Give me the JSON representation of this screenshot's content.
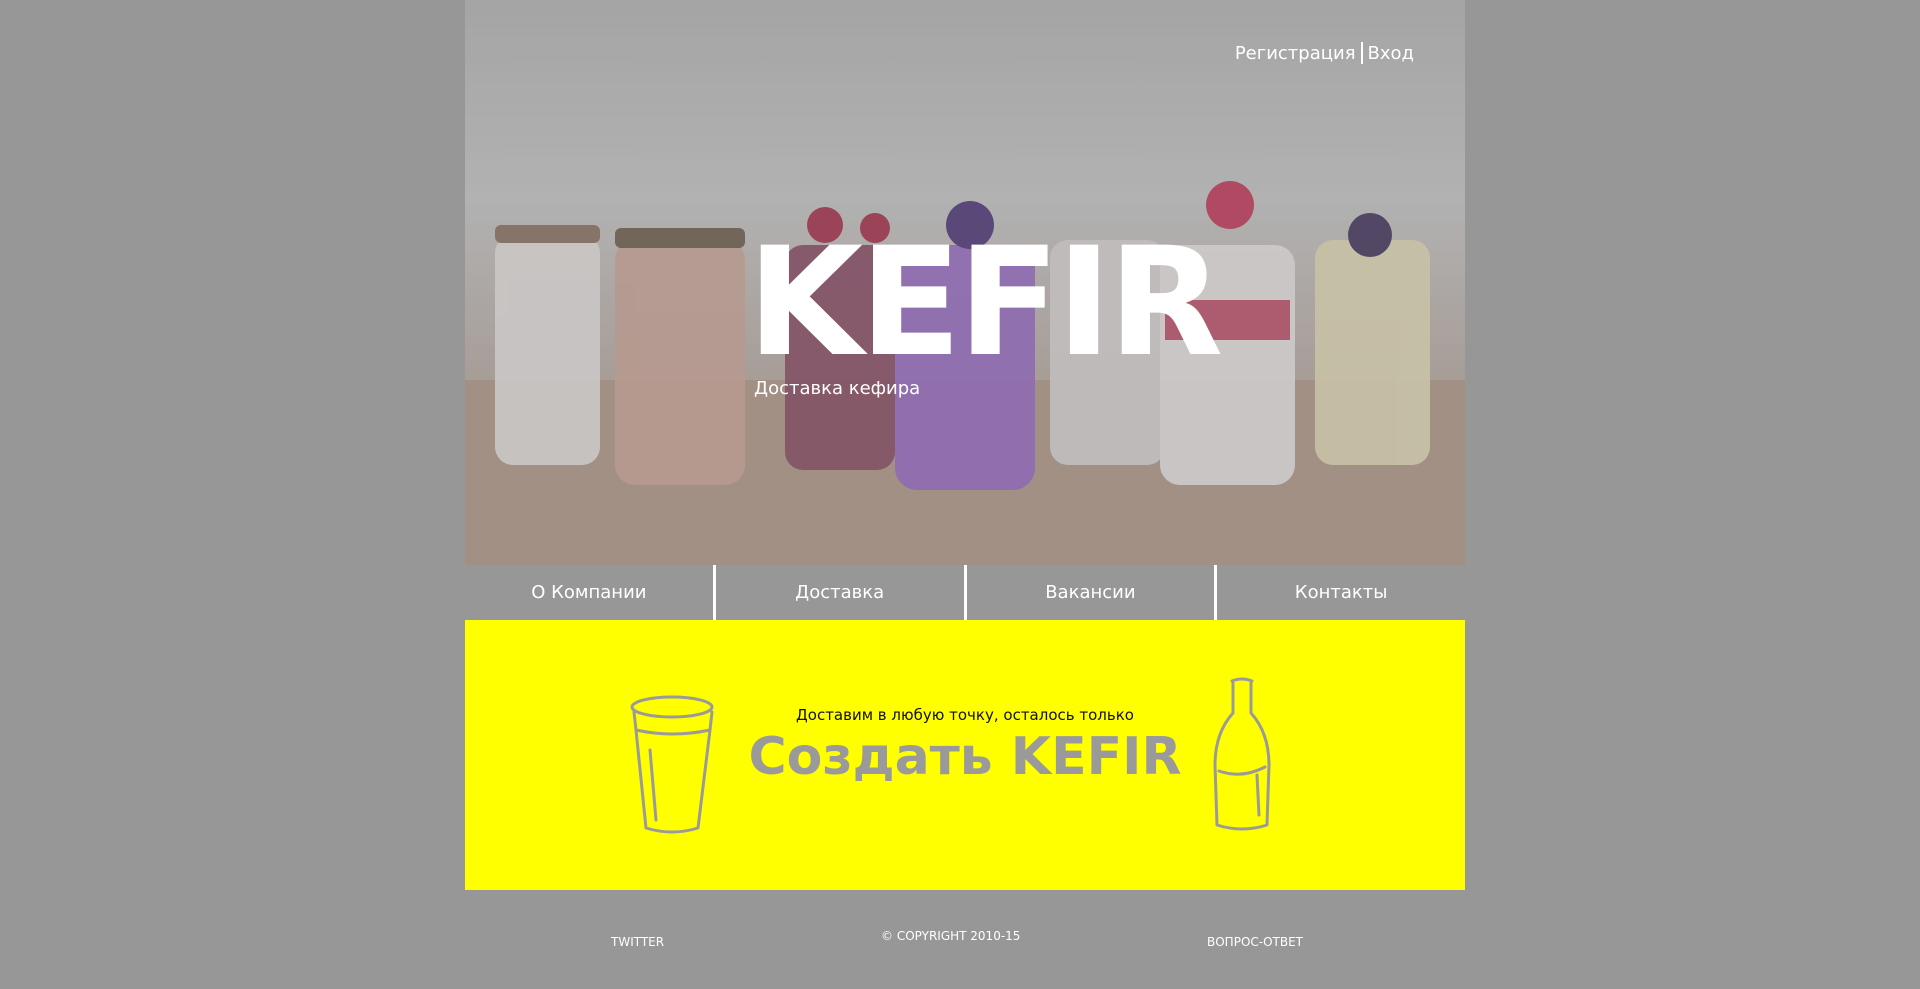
{
  "header": {
    "register_label": "Регистрация",
    "login_label": "Вход"
  },
  "hero": {
    "brand": "KEFIR",
    "tagline": "Доставка кефира"
  },
  "nav": {
    "items": [
      {
        "label": "О Компании"
      },
      {
        "label": "Доставка"
      },
      {
        "label": "Вакансии"
      },
      {
        "label": "Контакты"
      }
    ]
  },
  "cta": {
    "subtitle": "Доставим в любую точку, осталось только",
    "button_label": "Создать KEFIR",
    "background_color": "#ffff00"
  },
  "footer": {
    "twitter_label": "TWITTER",
    "copyright": "© COPYRIGHT 2010-15",
    "faq_label": "ВОПРОС-ОТВЕТ"
  },
  "colors": {
    "page_background": "#979797",
    "accent_yellow": "#ffff00",
    "text_light": "#ffffff"
  }
}
